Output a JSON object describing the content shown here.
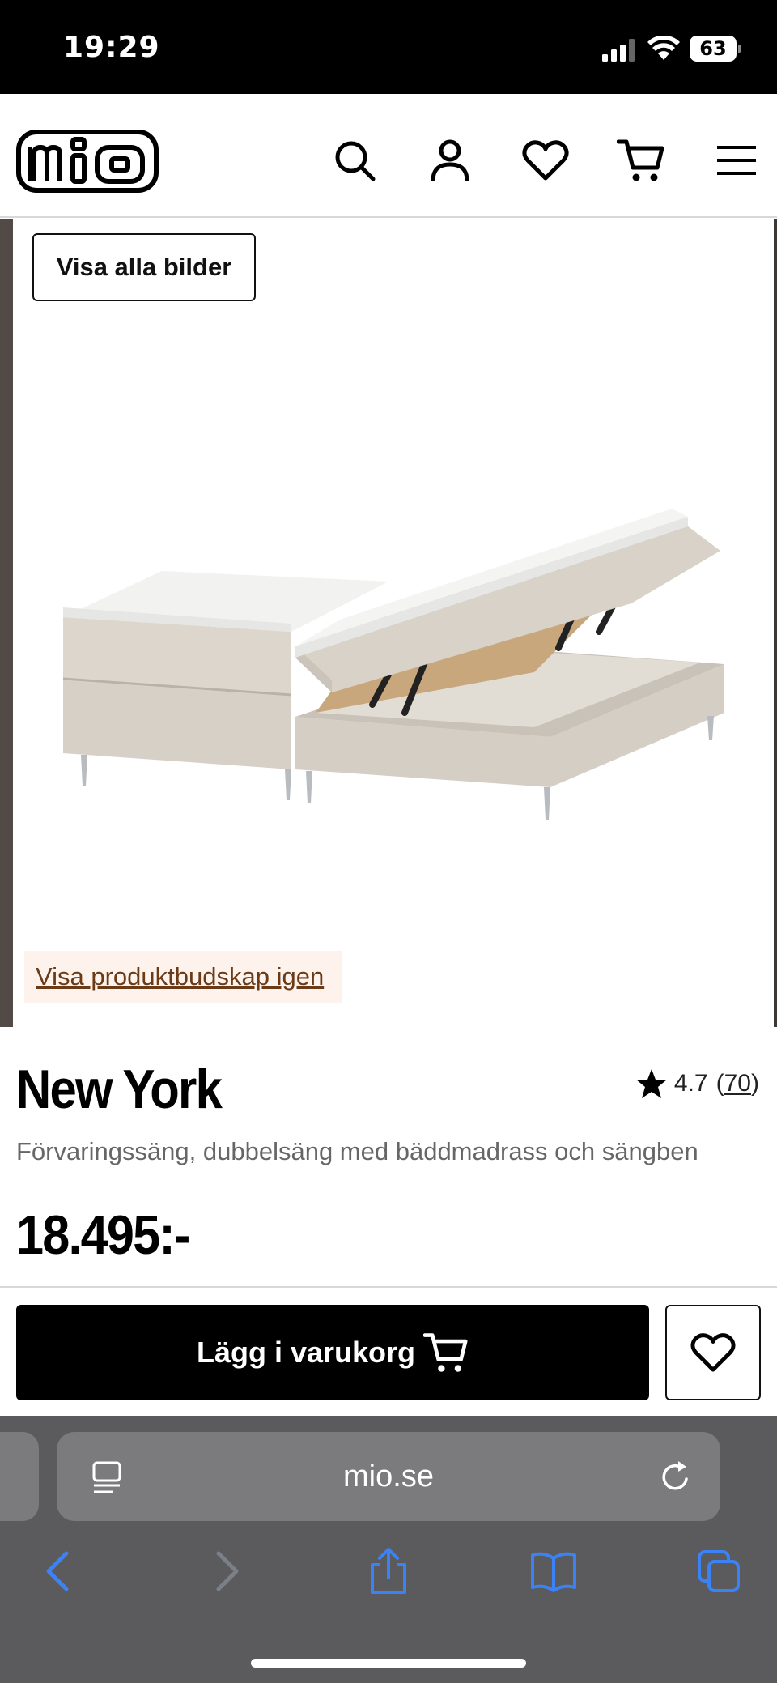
{
  "status_bar": {
    "time": "19:29",
    "battery": "63"
  },
  "header": {
    "logo_text": "mio",
    "icons": [
      "search-icon",
      "account-icon",
      "heart-icon",
      "cart-icon",
      "menu-icon"
    ]
  },
  "gallery": {
    "show_all_label": "Visa alla bilder",
    "product_message_label": "Visa produktbudskap igen"
  },
  "product": {
    "title": "New York",
    "rating": "4.7",
    "review_count_open": "(",
    "review_count": "70",
    "review_count_close": ")",
    "subtitle": "Förvaringssäng, dubbelsäng med bäddmadrass och sängben",
    "price": "18.495:-"
  },
  "actions": {
    "add_to_cart_label": "Lägg i varukorg"
  },
  "browser": {
    "url": "mio.se"
  },
  "colors": {
    "accent_link": "#6b3a16",
    "safari_blue": "#3b82f6",
    "button_black": "#000000"
  }
}
